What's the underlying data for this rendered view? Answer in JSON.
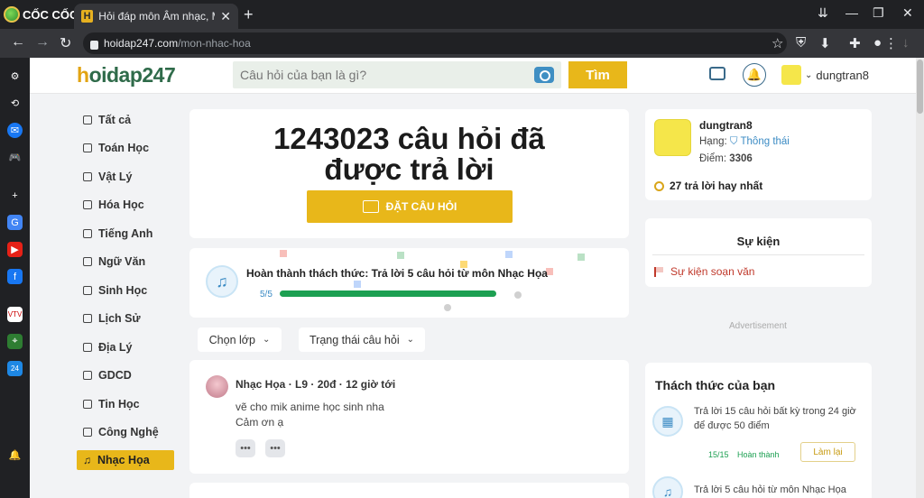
{
  "browser": {
    "brand": "CỐC CỐC",
    "tab_favicon": "H",
    "tab_title": "Hỏi đáp môn Âm nhạc, Mỹ thuật",
    "url_host": "hoidap247.com",
    "url_path": "/mon-nhac-hoa"
  },
  "header": {
    "logo_h": "h",
    "logo_rest": "oidap247",
    "search_placeholder": "Câu hỏi của bạn là gì?",
    "search_button": "Tìm",
    "username": "dungtran8"
  },
  "sidebar": {
    "items": [
      {
        "label": "Tất cả"
      },
      {
        "label": "Toán Học"
      },
      {
        "label": "Vật Lý"
      },
      {
        "label": "Hóa Học"
      },
      {
        "label": "Tiếng Anh"
      },
      {
        "label": "Ngữ Văn"
      },
      {
        "label": "Sinh Học"
      },
      {
        "label": "Lịch Sử"
      },
      {
        "label": "Địa Lý"
      },
      {
        "label": "GDCD"
      },
      {
        "label": "Tin Học"
      },
      {
        "label": "Công Nghệ"
      },
      {
        "label": "Nhạc Họa"
      }
    ],
    "active": "Nhạc Họa"
  },
  "main": {
    "stat_line1": "1243023 câu hỏi đã",
    "stat_line2": "được trả lời",
    "ask_button": "ĐẶT CÂU HỎI",
    "challenge": {
      "title": "Hoàn thành thách thức: Trả lời 5 câu hỏi  từ môn Nhạc Họa",
      "progress_text": "5/5",
      "progress": 1.0
    },
    "filters": {
      "grade": "Chọn lớp",
      "status": "Trạng thái câu hỏi"
    },
    "question": {
      "subject": "Nhạc Họa",
      "grade": "L9",
      "points": "20đ",
      "time": "12 giờ tới",
      "line1": "vẽ cho mik anime  học sinh nha",
      "line2": "Cảm ơn ạ"
    }
  },
  "profile": {
    "name": "dungtran8",
    "rank_label": "Hạng:",
    "rank_value": "Thông thái",
    "points_label": "Điểm:",
    "points_value": "3306",
    "best_answers": "27 trả lời hay nhất"
  },
  "events": {
    "title": "Sự kiện",
    "item": "Sự kiện soạn văn"
  },
  "advertisement": "Advertisement",
  "challenges": {
    "title": "Thách thức của bạn",
    "items": [
      {
        "text": "Trả lời 15 câu hỏi  bất kỳ  trong 24 giờ để được 50 điểm",
        "progress": "15/15",
        "status": "Hoàn thành",
        "action": "Làm lại"
      },
      {
        "text": "Trả lời 5 câu hỏi  từ môn Nhạc Họa"
      }
    ]
  },
  "colors": {
    "accent": "#e8b71a",
    "link": "#3b8bc4",
    "success": "#1da052"
  }
}
